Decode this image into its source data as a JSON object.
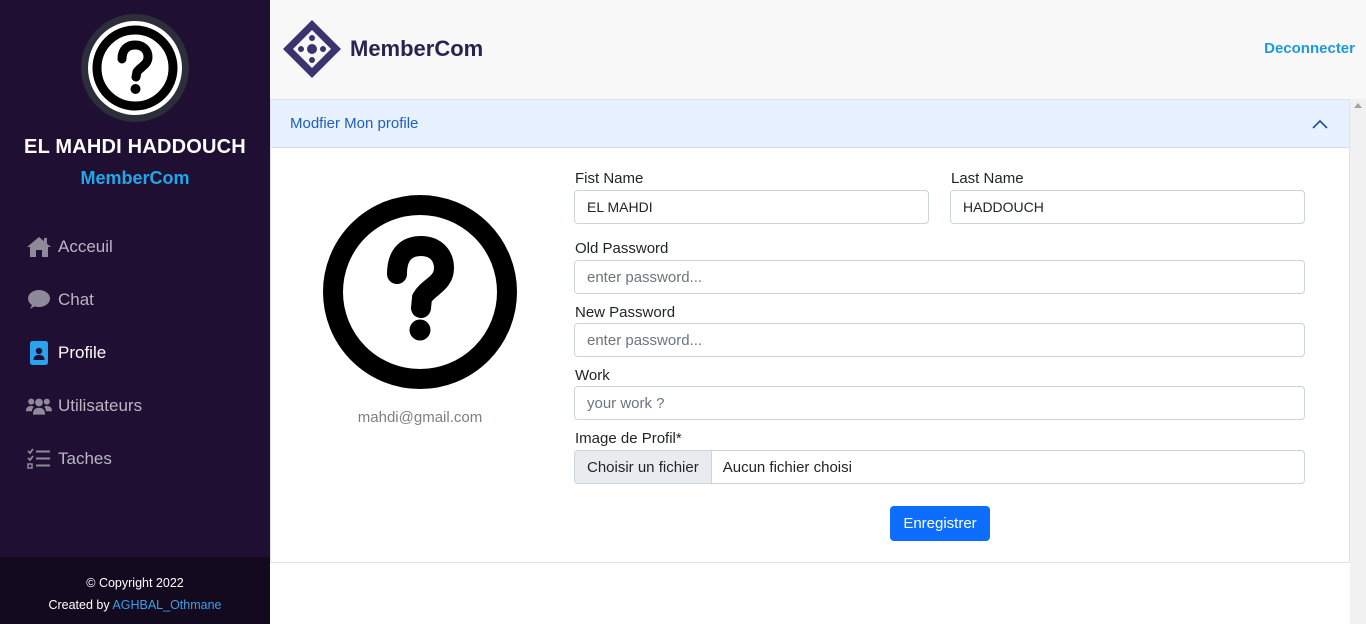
{
  "sidebar": {
    "user_name": "EL MAHDI HADDOUCH",
    "brand": "MemberCom",
    "items": [
      {
        "label": "Acceuil",
        "icon": "home-icon",
        "active": false
      },
      {
        "label": "Chat",
        "icon": "chat-bubble-icon",
        "active": false
      },
      {
        "label": "Profile",
        "icon": "id-badge-icon",
        "active": true
      },
      {
        "label": "Utilisateurs",
        "icon": "users-icon",
        "active": false
      },
      {
        "label": "Taches",
        "icon": "task-list-icon",
        "active": false
      }
    ],
    "footer": {
      "copyright": "© Copyright 2022",
      "created_by": "Created by",
      "author": "AGHBAL_Othmane"
    }
  },
  "header": {
    "logo_text": "MemberCom",
    "logout_label": "Deconnecter"
  },
  "card": {
    "title": "Modfier Mon profile",
    "email": "mahdi@gmail.com",
    "form": {
      "first_name_label": "Fist Name",
      "first_name_value": "EL MAHDI",
      "last_name_label": "Last Name",
      "last_name_value": "HADDOUCH",
      "old_password_label": "Old Password",
      "old_password_placeholder": "enter password...",
      "new_password_label": "New Password",
      "new_password_placeholder": "enter password...",
      "work_label": "Work",
      "work_placeholder": "your work ?",
      "image_label": "Image de Profil*",
      "file_button": "Choisir un fichier",
      "file_status": "Aucun fichier choisi",
      "save_label": "Enregistrer"
    }
  },
  "colors": {
    "sidebar_bg": "#1f0f33",
    "accent": "#22a7e6",
    "primary_button": "#0d6efd",
    "card_header_bg": "#e7f1ff"
  }
}
